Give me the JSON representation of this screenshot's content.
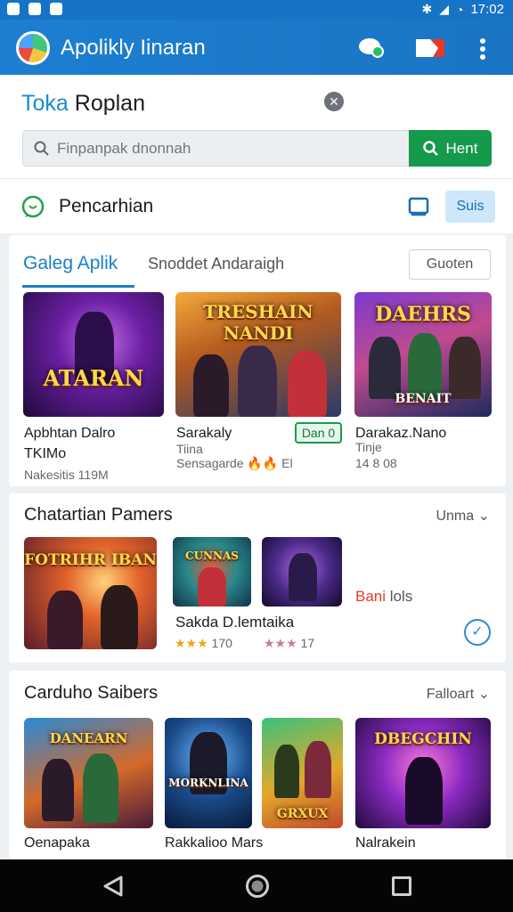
{
  "status_bar": {
    "time": "17:02"
  },
  "app_bar": {
    "title": "Apolikly Iinaran"
  },
  "store": {
    "title_part1": "Toka",
    "title_part2": "Roplan",
    "search_placeholder": "Finpanpak dnonnah",
    "search_button": "Hent"
  },
  "search_row": {
    "label": "Pencarhian",
    "button": "Suis"
  },
  "gallery": {
    "tab_active": "Galeg Aplik",
    "tab_other": "Snoddet Andaraigh",
    "button": "Guoten",
    "items": [
      {
        "art_title": "ATARAN",
        "title": "Apbhtan Dalro",
        "subtitle": "TKIMo",
        "meta": "Nakesitis 119M"
      },
      {
        "art_title": "TRESHAIN NANDI",
        "title": "Sarakaly",
        "subtitle": "Tiina",
        "meta": "Sensagarde",
        "meta_badge": "🔥🔥",
        "meta_tail": "El",
        "badge": "Dan 0"
      },
      {
        "art_title": "DAEHRS",
        "art_sub": "BENAIT",
        "title": "Darakaz.Nano",
        "subtitle": "Tinje",
        "meta": "14 8 08"
      }
    ]
  },
  "section2": {
    "title": "Chatartian Pamers",
    "more": "Unma",
    "art1": "FOTRIHR IBAN",
    "art2": "CUNNAS",
    "red_label": "Bani",
    "red_label_tail": "lols",
    "item_title": "Sakda D.lemtaika",
    "rating1_stars": "★★★",
    "rating1_value": "170",
    "rating2_stars": "★★★",
    "rating2_value": "17"
  },
  "section3": {
    "title": "Carduho Saibers",
    "more": "Falloart",
    "items": [
      {
        "art": "DANEARN",
        "label": "Oenapaka"
      },
      {
        "art": "MORKNLINA",
        "label": "Rakkalioo Mars"
      },
      {
        "art": "GRXUX",
        "label": ""
      },
      {
        "art": "DBEGCHIN",
        "label": "Nalrakein"
      }
    ]
  },
  "colors": {
    "primary": "#1a74c4",
    "green": "#15994a",
    "accent_blue": "#1a7fc7",
    "red": "#e53a2a"
  },
  "icons": [
    "app-logo-icon",
    "chat-icon",
    "flag-icon",
    "more-vert-icon",
    "search-icon",
    "close-icon",
    "whatsapp-icon",
    "book-icon",
    "chevron-down-icon",
    "check-circle-icon",
    "back-icon",
    "home-icon",
    "recents-icon"
  ]
}
